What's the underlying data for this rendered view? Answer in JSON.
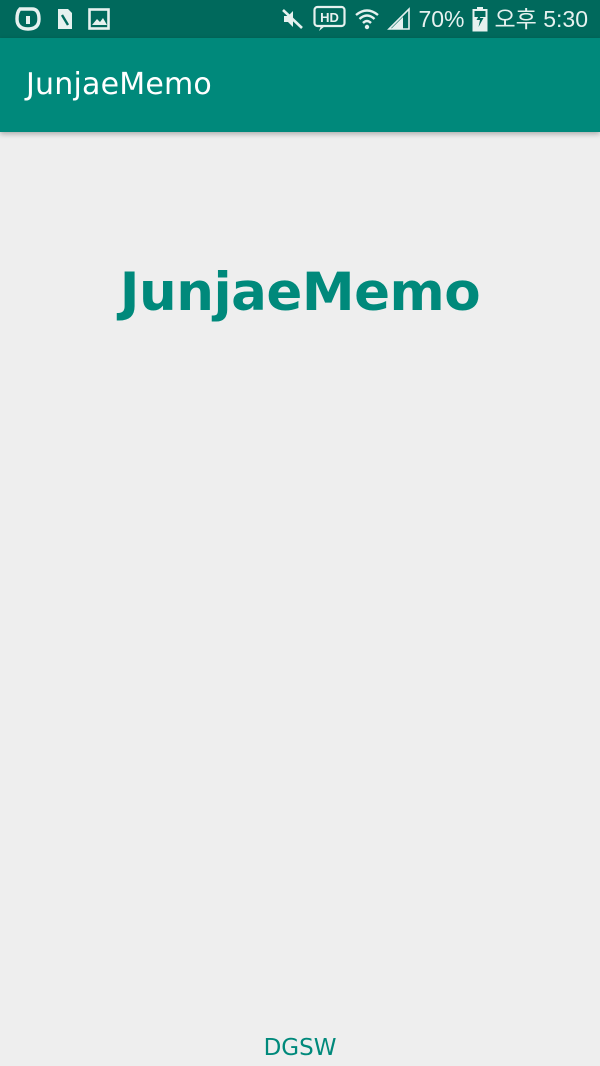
{
  "status_bar": {
    "left_icons": [
      "o-brand-icon",
      "sim-card-icon",
      "image-icon"
    ],
    "right_icons": [
      "mute-icon",
      "hd-voice-icon",
      "wifi-icon",
      "signal-icon",
      "battery-charging-icon"
    ],
    "battery": "70%",
    "time": "오후 5:30",
    "hd_label": "HD"
  },
  "app_bar": {
    "title": "JunjaeMemo",
    "color": "#00897b"
  },
  "main": {
    "heading": "JunjaeMemo",
    "heading_color": "#00897b"
  },
  "footer": {
    "label": "DGSW"
  },
  "colors": {
    "status_bar": "#00695c",
    "app_bar": "#00897b",
    "background": "#eeeeee",
    "accent_text": "#00897b"
  }
}
